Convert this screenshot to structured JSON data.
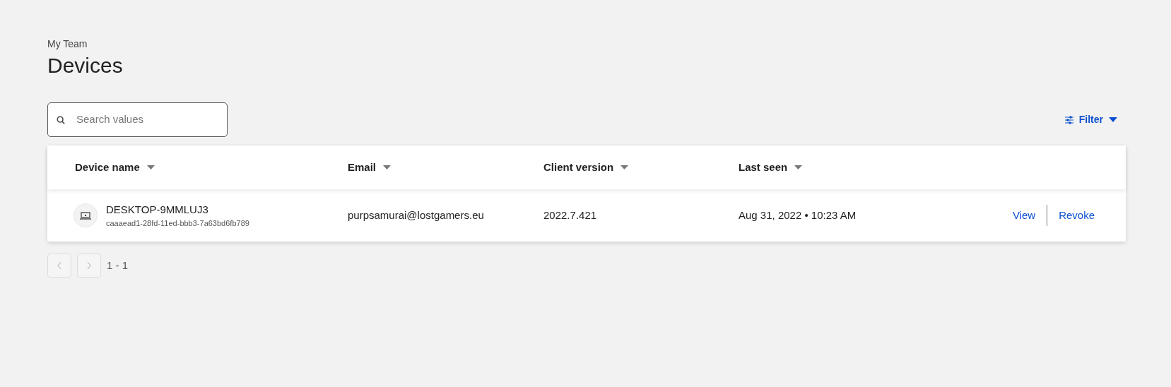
{
  "breadcrumb": "My Team",
  "title": "Devices",
  "search": {
    "placeholder": "Search values"
  },
  "filter": {
    "label": "Filter"
  },
  "table": {
    "columns": [
      "Device name",
      "Email",
      "Client version",
      "Last seen"
    ],
    "rows": [
      {
        "device_name": "DESKTOP-9MMLUJ3",
        "device_id": "caaaead1-28fd-11ed-bbb3-7a63bd6fb789",
        "email": "purpsamurai@lostgamers.eu",
        "client_version": "2022.7.421",
        "last_seen": "Aug 31, 2022 • 10:23 AM",
        "actions": [
          "View",
          "Revoke"
        ]
      }
    ]
  },
  "pagination": {
    "prev_disabled": true,
    "next_disabled": true,
    "range": "1 - 1"
  }
}
